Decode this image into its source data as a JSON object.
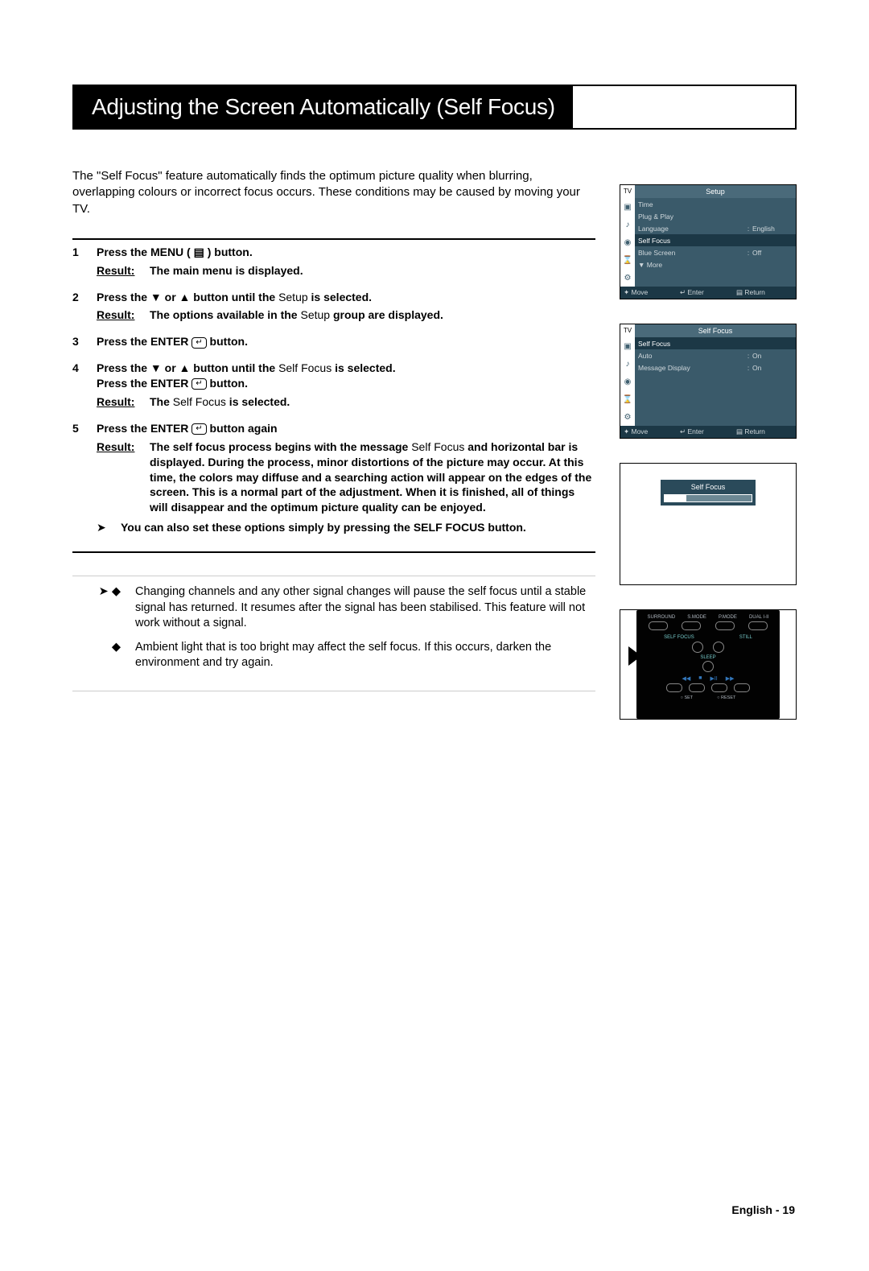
{
  "title": "Adjusting the Screen Automatically (Self Focus)",
  "intro": "The \"Self Focus\" feature automatically finds the optimum picture quality when blurring, overlapping colours or incorrect focus occurs. These conditions may be caused by moving your TV.",
  "steps": {
    "s1": {
      "num": "1",
      "text_a": "Press the ",
      "menu": "MENU",
      "text_b": " ( ▤ ) button.",
      "result": "The main menu is displayed."
    },
    "s2": {
      "num": "2",
      "text_a": "Press the ▼ or ▲ button until the ",
      "setup": "Setup",
      "text_b": " is selected.",
      "result_a": "The options available in the ",
      "result_setup": "Setup",
      "result_b": " group are displayed."
    },
    "s3": {
      "num": "3",
      "text_a": "Press the ",
      "enter": "ENTER",
      "text_b": " ( ↵ ) button."
    },
    "s4": {
      "num": "4",
      "line1_a": "Press the ▼ or ▲ button until the ",
      "self_focus": "Self Focus",
      "line1_b": " is selected.",
      "line2_a": "Press the ",
      "enter": "ENTER",
      "line2_b": " ( ↵ ) button.",
      "result_a": "The ",
      "result_sf": "Self Focus",
      "result_b": " is selected."
    },
    "s5": {
      "num": "5",
      "text_a": "Press the ",
      "enter": "ENTER",
      "text_b": " ( ↵ ) button again",
      "result_label": "Result:",
      "result_body_a": "The self focus process begins with the message ",
      "result_sf": "Self Focus",
      "result_body_b": " and horizontal bar is displayed. During the process, minor distortions of the picture may occur. At this time, the colors may diffuse and a searching action will appear on the edges of the screen. This is a normal part of the adjustment. When it is finished, all of things will disappear and the optimum picture quality can be enjoyed."
    },
    "tip_a": "You can also set these options simply by pressing the ",
    "tip_b": "SELF FOCUS button.",
    "result_label": "Result:"
  },
  "notes": {
    "n1": "Changing channels and any other signal changes will pause the self focus until a stable signal has returned. It resumes after the signal has been stabilised. This feature will not work without a signal.",
    "n2": "Ambient light that is too bright may affect the self focus. If this occurs, darken the environment and try again."
  },
  "osd1": {
    "tv": "TV",
    "title": "Setup",
    "items": [
      {
        "label": "Time",
        "colon": "",
        "val": ""
      },
      {
        "label": "Plug & Play",
        "colon": "",
        "val": ""
      },
      {
        "label": "Language",
        "colon": ":",
        "val": "English"
      },
      {
        "label": "Self Focus",
        "colon": "",
        "val": "",
        "sel": true
      },
      {
        "label": "Blue Screen",
        "colon": ":",
        "val": "Off"
      },
      {
        "label": "▼ More",
        "colon": "",
        "val": ""
      }
    ],
    "footer": {
      "move": "✦ Move",
      "enter": "↵ Enter",
      "ret": "▤ Return"
    }
  },
  "osd2": {
    "tv": "TV",
    "title": "Self Focus",
    "items": [
      {
        "label": "Self Focus",
        "colon": "",
        "val": "",
        "sel": true
      },
      {
        "label": "Auto",
        "colon": ":",
        "val": "On"
      },
      {
        "label": "Message Display",
        "colon": ":",
        "val": "On"
      },
      {
        "label": "",
        "colon": "",
        "val": ""
      },
      {
        "label": "",
        "colon": "",
        "val": ""
      },
      {
        "label": "",
        "colon": "",
        "val": ""
      }
    ],
    "footer": {
      "move": "✦ Move",
      "enter": "↵ Enter",
      "ret": "▤ Return"
    }
  },
  "progress": {
    "label": "Self Focus"
  },
  "remote": {
    "top": [
      "SURROUND",
      "S.MODE",
      "P.MODE",
      "DUAL I-II"
    ],
    "mid": [
      "SELF FOCUS",
      "STILL"
    ],
    "sleep": "SLEEP",
    "transport": [
      "◀◀",
      "■",
      "▶II",
      "▶▶"
    ],
    "set": [
      "○ SET",
      "○ RESET"
    ]
  },
  "footer": "English - 19"
}
